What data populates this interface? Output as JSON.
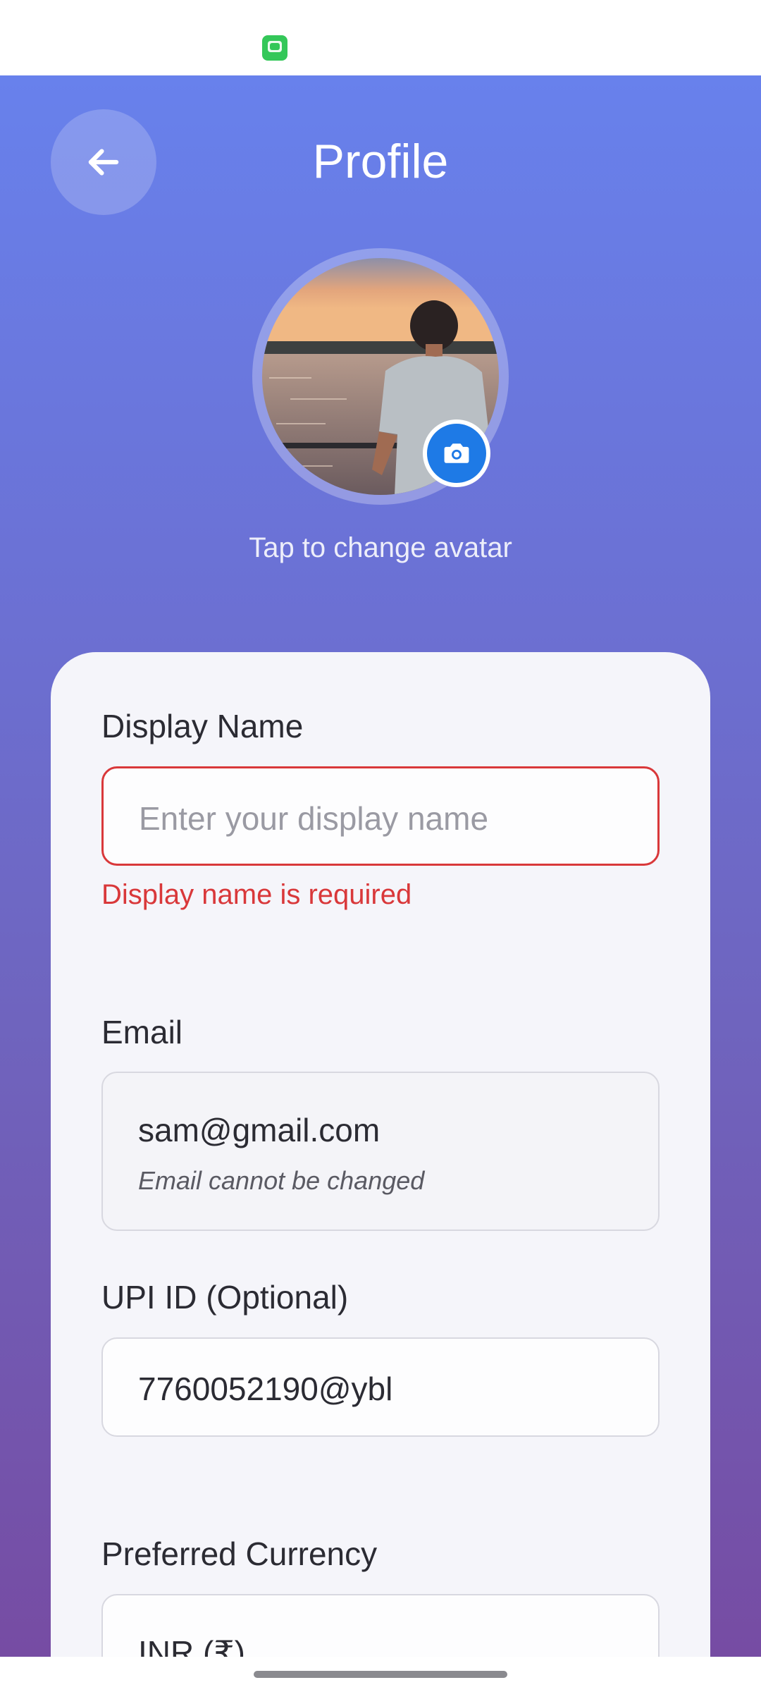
{
  "status_bar": {
    "app_icon": "messages-app-icon"
  },
  "header": {
    "title": "Profile",
    "back_icon": "arrow-left-icon"
  },
  "avatar": {
    "hint": "Tap to change avatar",
    "camera_icon": "camera-icon"
  },
  "form": {
    "display_name": {
      "label": "Display Name",
      "value": "",
      "placeholder": "Enter your display name",
      "error": "Display name is required"
    },
    "email": {
      "label": "Email",
      "value": "sam@gmail.com",
      "note": "Email cannot be changed"
    },
    "upi": {
      "label": "UPI ID (Optional)",
      "value": "7760052190@ybl"
    },
    "currency": {
      "label": "Preferred Currency",
      "value": "INR (₹)"
    }
  },
  "colors": {
    "gradient_top": "#6881ec",
    "gradient_bottom": "#764ca3",
    "error": "#d9383a",
    "camera_button": "#1e7ae6"
  }
}
